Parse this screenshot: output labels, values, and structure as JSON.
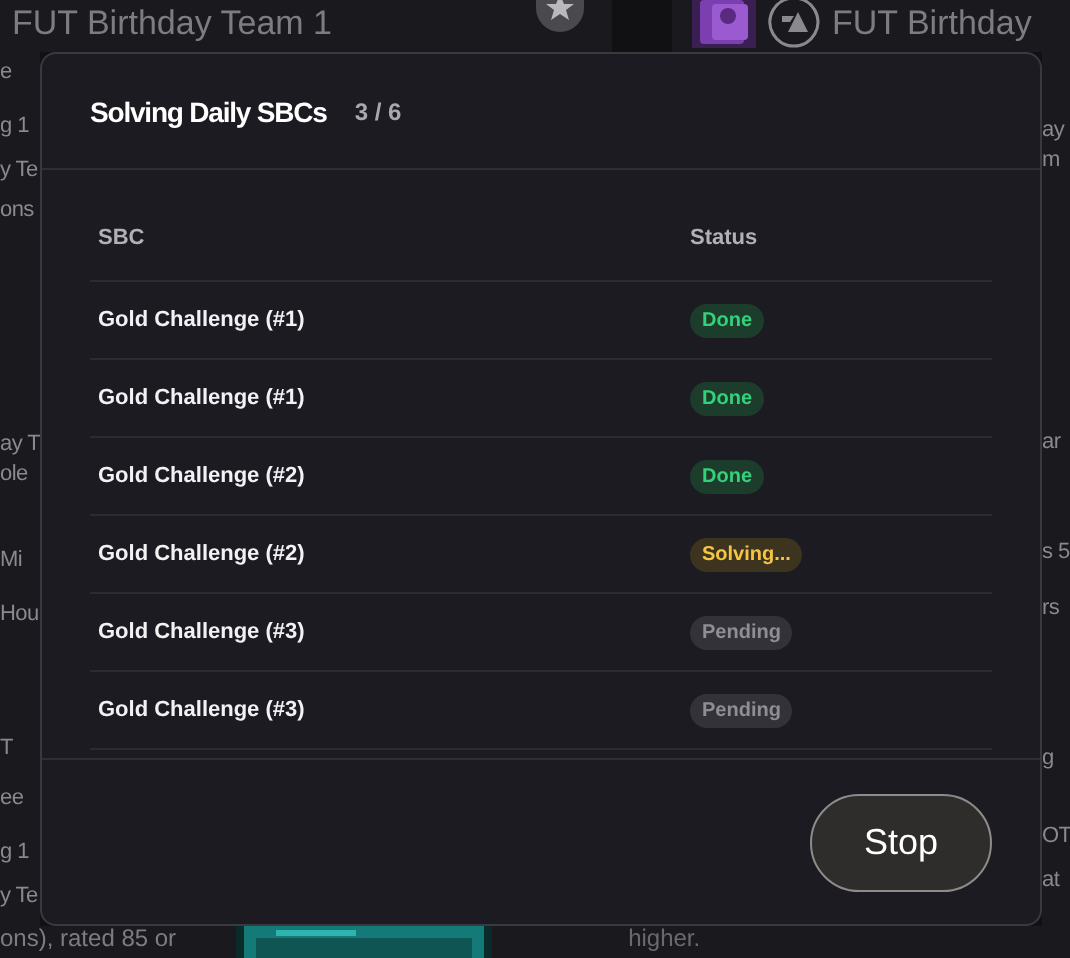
{
  "background": {
    "top_left_title": "FUT Birthday Team 1",
    "top_right_title": "FUT Birthday",
    "left_fragments": [
      "e",
      "g 1",
      "y Te",
      "ons",
      "ay T",
      "ole",
      "Mi",
      "Hou",
      "T",
      "ee",
      "g 1",
      "y Te"
    ],
    "right_fragments": [
      "ay",
      "m",
      "ar",
      "s 5",
      "rs",
      "g",
      "OT",
      "at"
    ],
    "bottom_left": "ons), rated 85 or",
    "bottom_right": "higher."
  },
  "dialog": {
    "title": "Solving Daily SBCs",
    "progress": "3 / 6",
    "columns": [
      "SBC",
      "Status"
    ],
    "rows": [
      {
        "name": "Gold Challenge (#1)",
        "status": "Done",
        "kind": "done"
      },
      {
        "name": "Gold Challenge (#1)",
        "status": "Done",
        "kind": "done"
      },
      {
        "name": "Gold Challenge (#2)",
        "status": "Done",
        "kind": "done"
      },
      {
        "name": "Gold Challenge (#2)",
        "status": "Solving...",
        "kind": "solving"
      },
      {
        "name": "Gold Challenge (#3)",
        "status": "Pending",
        "kind": "pending"
      },
      {
        "name": "Gold Challenge (#3)",
        "status": "Pending",
        "kind": "pending"
      }
    ],
    "button": "Stop"
  }
}
